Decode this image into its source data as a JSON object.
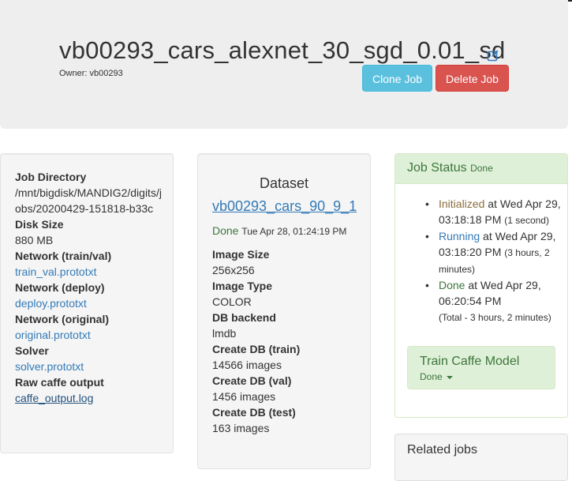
{
  "header": {
    "job_name": "vb00293_cars_alexnet_30_sgd_0.01_sd",
    "owner": "Owner: vb00293",
    "clone_label": "Clone Job",
    "delete_label": "Delete Job"
  },
  "job_info": [
    {
      "term": "Job Directory",
      "value": "/mnt/bigdisk/MANDIG2/digits/jobs/20200429-151818-b33c"
    },
    {
      "term": "Disk Size",
      "value": "880 MB"
    },
    {
      "term": "Network (train/val)",
      "value": "train_val.prototxt",
      "link": true
    },
    {
      "term": "Network (deploy)",
      "value": "deploy.prototxt",
      "link": true
    },
    {
      "term": "Network (original)",
      "value": "original.prototxt",
      "link": true
    },
    {
      "term": "Solver",
      "value": "solver.prototxt",
      "link": true
    },
    {
      "term": "Raw caffe output",
      "value": "caffe_output.log",
      "link": true
    }
  ],
  "dataset": {
    "heading": "Dataset",
    "name": "vb00293_cars_90_9_1",
    "status": "Done",
    "status_time": "Tue Apr 28, 01:24:19 PM",
    "info": [
      {
        "term": "Image Size",
        "value": "256x256"
      },
      {
        "term": "Image Type",
        "value": "COLOR"
      },
      {
        "term": "DB backend",
        "value": "lmdb"
      },
      {
        "term": "Create DB (train)",
        "value": "14566 images"
      },
      {
        "term": "Create DB (val)",
        "value": "1456 images"
      },
      {
        "term": "Create DB (test)",
        "value": "163 images"
      }
    ]
  },
  "job_status": {
    "title": "Job Status",
    "state": "Done",
    "bullet": "•",
    "items": [
      {
        "state": "Initialized",
        "text": " at Wed Apr 29, 03:18:18 PM ",
        "duration": "(1 second)"
      },
      {
        "state": "Running",
        "text": " at Wed Apr 29, 03:18:20 PM ",
        "duration": "(3 hours, 2 minutes)"
      },
      {
        "state": "Done",
        "text": " at Wed Apr 29, 06:20:54 PM",
        "duration": "(Total - 3 hours, 2 minutes)"
      }
    ],
    "colors": {
      "initialized": "#8a6d3b",
      "running": "#337ab7",
      "done": "#3c763d"
    }
  },
  "train_task": {
    "title": "Train Caffe Model",
    "state": "Done"
  },
  "related": {
    "title": "Related jobs"
  },
  "icons": {
    "edit": "edit-icon",
    "caret": "caret-down-icon"
  }
}
